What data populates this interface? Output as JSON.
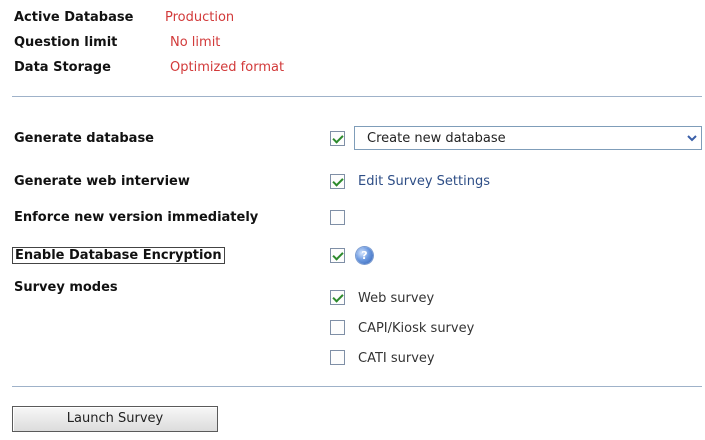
{
  "info": {
    "active_database_label": "Active Database",
    "active_database_value": "Production",
    "question_limit_label": "Question limit",
    "question_limit_value": "No limit",
    "data_storage_label": "Data Storage",
    "data_storage_value": "Optimized format"
  },
  "options": {
    "generate_database": {
      "label": "Generate database",
      "checked": true,
      "select_value": "Create new database"
    },
    "generate_web_interview": {
      "label": "Generate web interview",
      "checked": true,
      "link": "Edit Survey Settings"
    },
    "enforce_new_version": {
      "label": "Enforce new version immediately",
      "checked": false
    },
    "enable_encryption": {
      "label": "Enable Database Encryption",
      "checked": true,
      "help_icon": "help-icon"
    },
    "survey_modes": {
      "label": "Survey modes",
      "modes": [
        {
          "label": "Web survey",
          "checked": true
        },
        {
          "label": "CAPI/Kiosk survey",
          "checked": false
        },
        {
          "label": "CATI survey",
          "checked": false
        }
      ]
    }
  },
  "actions": {
    "launch_label": "Launch Survey"
  },
  "colors": {
    "value_red": "#d23a3a",
    "link_blue": "#2e4e86",
    "check_green": "#2c8a2c",
    "rule": "#9fb2c9"
  }
}
